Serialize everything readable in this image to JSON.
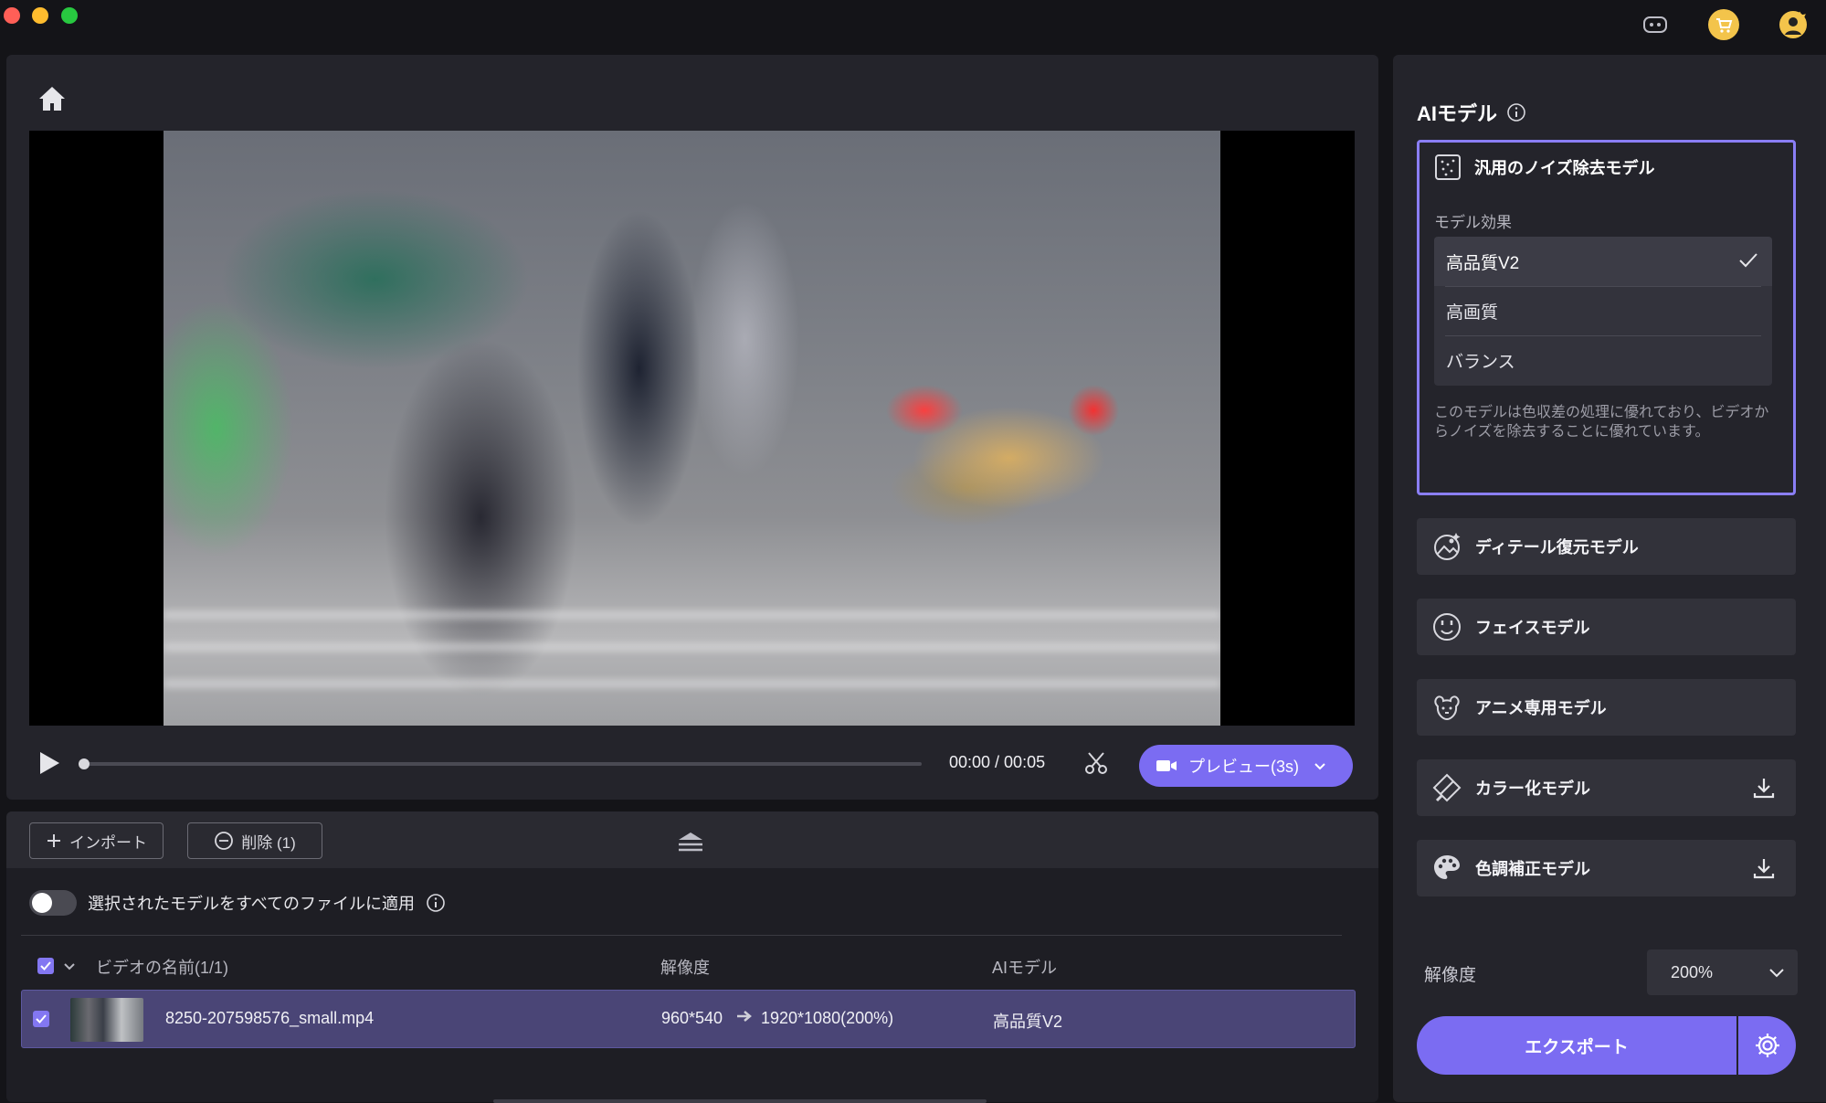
{
  "window": {
    "title": ""
  },
  "topbar": {
    "icons": [
      "discord-icon",
      "cart-icon",
      "user-crown-icon"
    ]
  },
  "player": {
    "time": "00:00 / 00:05",
    "preview_label": "プレビュー(3s)",
    "progress": 0
  },
  "toolbar": {
    "import_label": "インポート",
    "delete_label": "削除 (1)"
  },
  "apply_all": {
    "label": "選択されたモデルをすべてのファイルに適用",
    "enabled": false
  },
  "table": {
    "headers": {
      "name": "ビデオの名前(1/1)",
      "resolution": "解像度",
      "model": "AIモデル"
    },
    "rows": [
      {
        "filename": "8250-207598576_small.mp4",
        "res_from": "960*540",
        "res_to": "1920*1080(200%)",
        "model": "高品質V2",
        "checked": true
      }
    ]
  },
  "sidebar": {
    "title": "AIモデル",
    "active_model": {
      "name": "汎用のノイズ除去モデル",
      "effect_label": "モデル効果",
      "options": [
        "高品質V2",
        "高画質",
        "バランス"
      ],
      "selected": "高品質V2",
      "description": "このモデルは色収差の処理に優れており、ビデオからノイズを除去することに優れています。"
    },
    "models": [
      {
        "name": "ディテール復元モデル",
        "icon": "detail-restore-icon",
        "download": false
      },
      {
        "name": "フェイスモデル",
        "icon": "face-icon",
        "download": false
      },
      {
        "name": "アニメ専用モデル",
        "icon": "anime-icon",
        "download": false
      },
      {
        "name": "カラー化モデル",
        "icon": "colorize-icon",
        "download": true
      },
      {
        "name": "色調補正モデル",
        "icon": "palette-icon",
        "download": true
      }
    ],
    "resolution_label": "解像度",
    "resolution_value": "200%",
    "export_label": "エクスポート"
  },
  "colors": {
    "accent": "#7b6cf2",
    "panel": "#24242b",
    "background": "#141418"
  }
}
